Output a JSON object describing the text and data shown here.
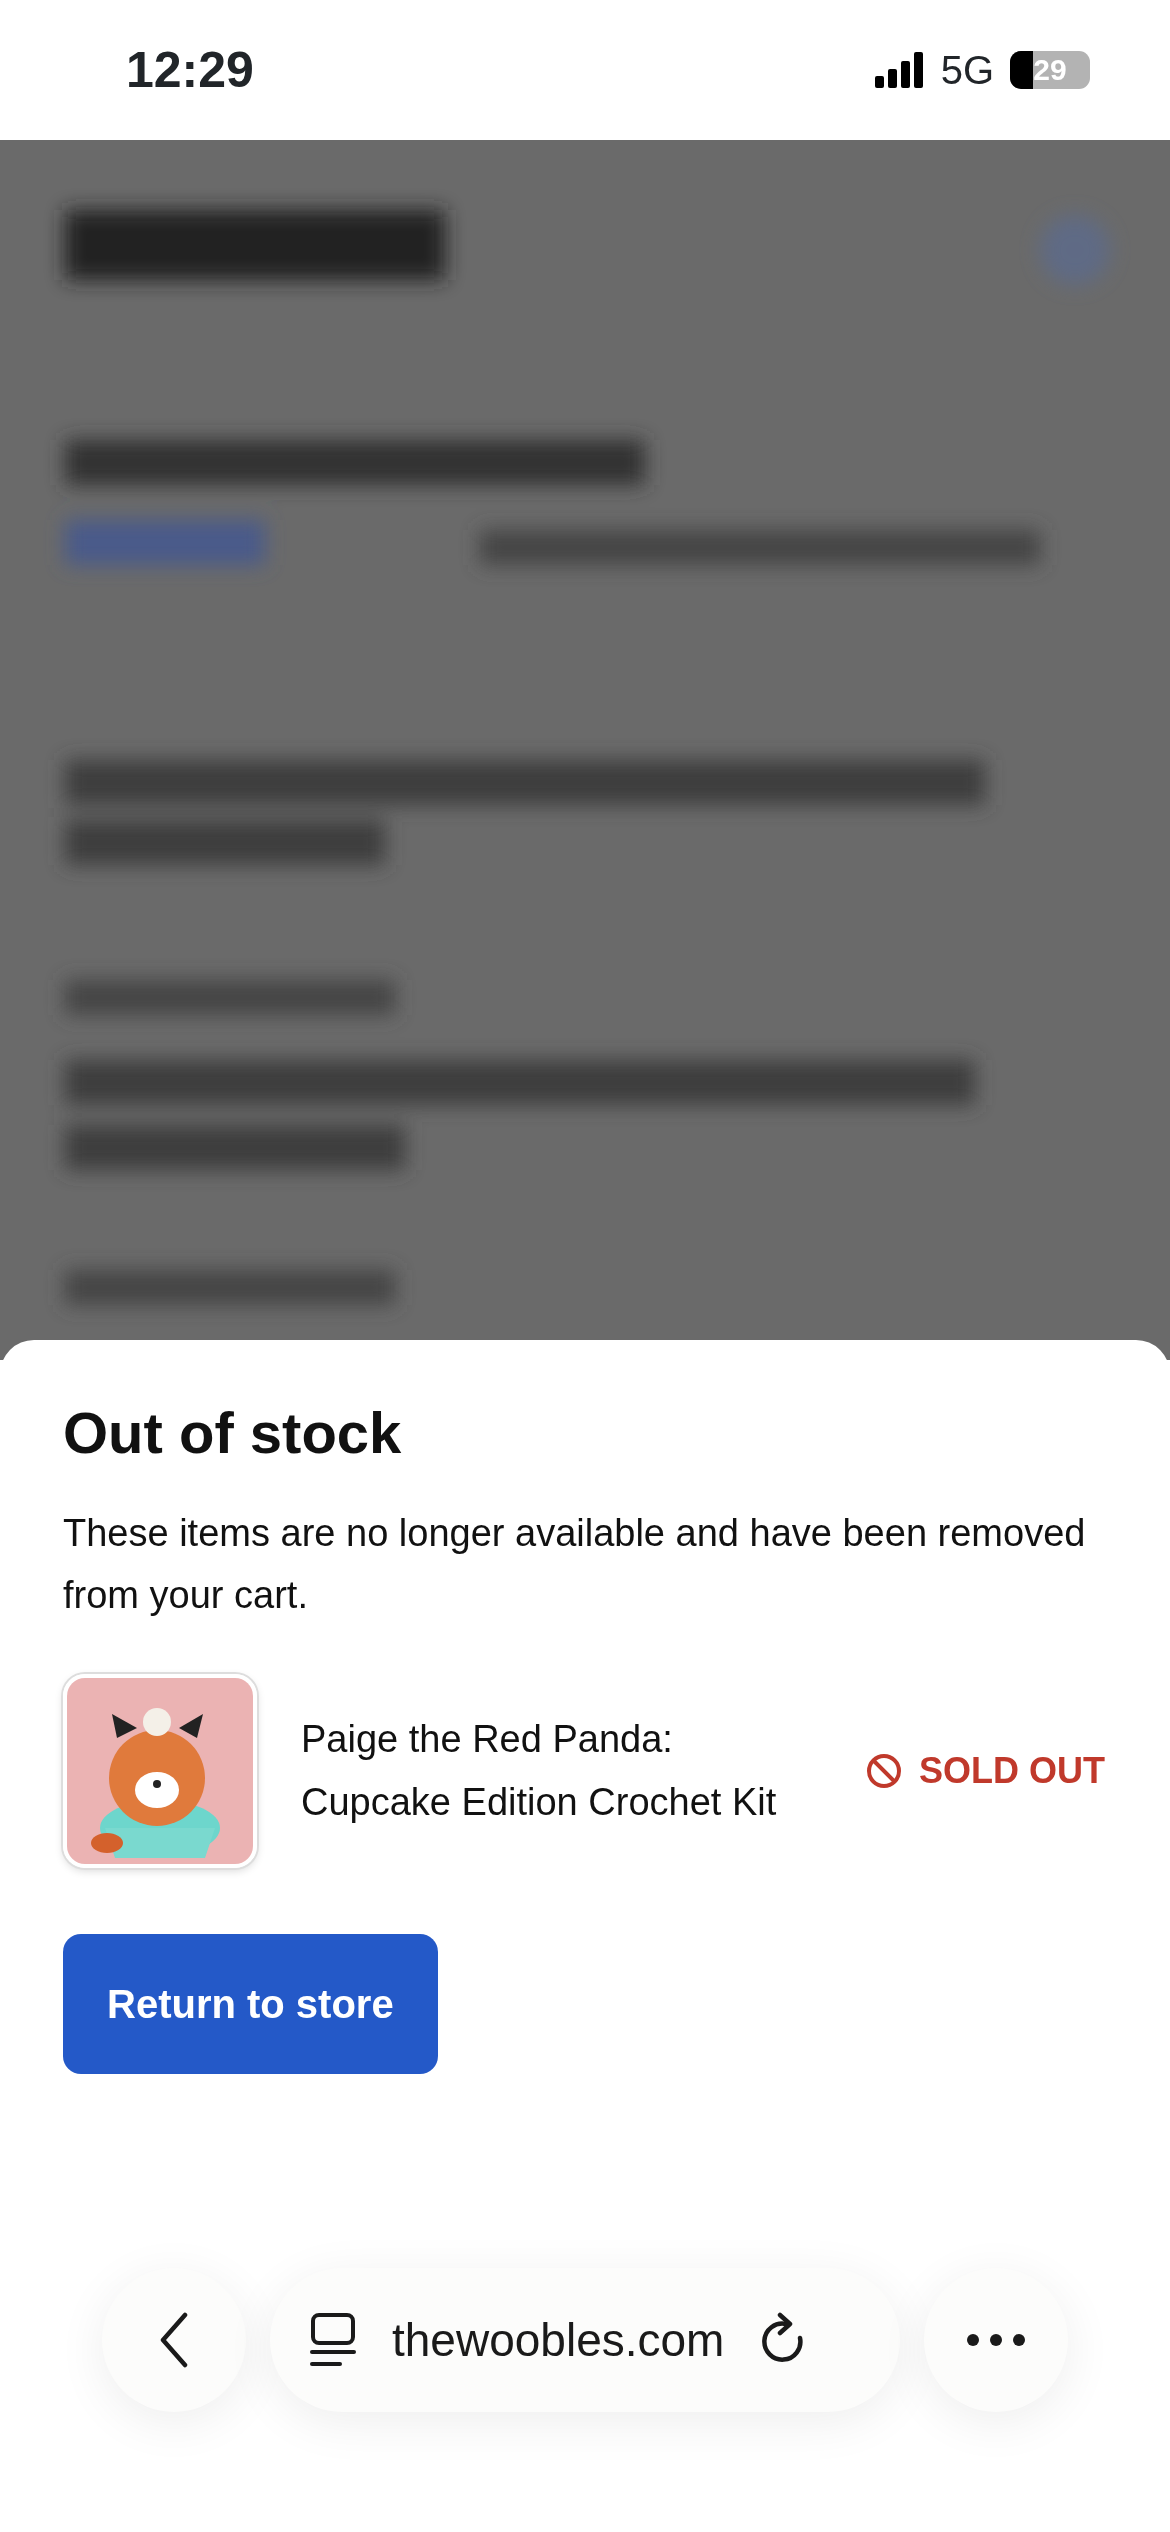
{
  "status_bar": {
    "time": "12:29",
    "network": "5G",
    "battery": "29"
  },
  "sheet": {
    "title": "Out of stock",
    "message": "These items are no longer available and have been removed from your cart.",
    "items": [
      {
        "name": "Paige the Red Panda: Cupcake Edition Crochet Kit",
        "status": "SOLD OUT"
      }
    ],
    "button": "Return to store"
  },
  "browser_bar": {
    "url": "thewoobles.com"
  }
}
